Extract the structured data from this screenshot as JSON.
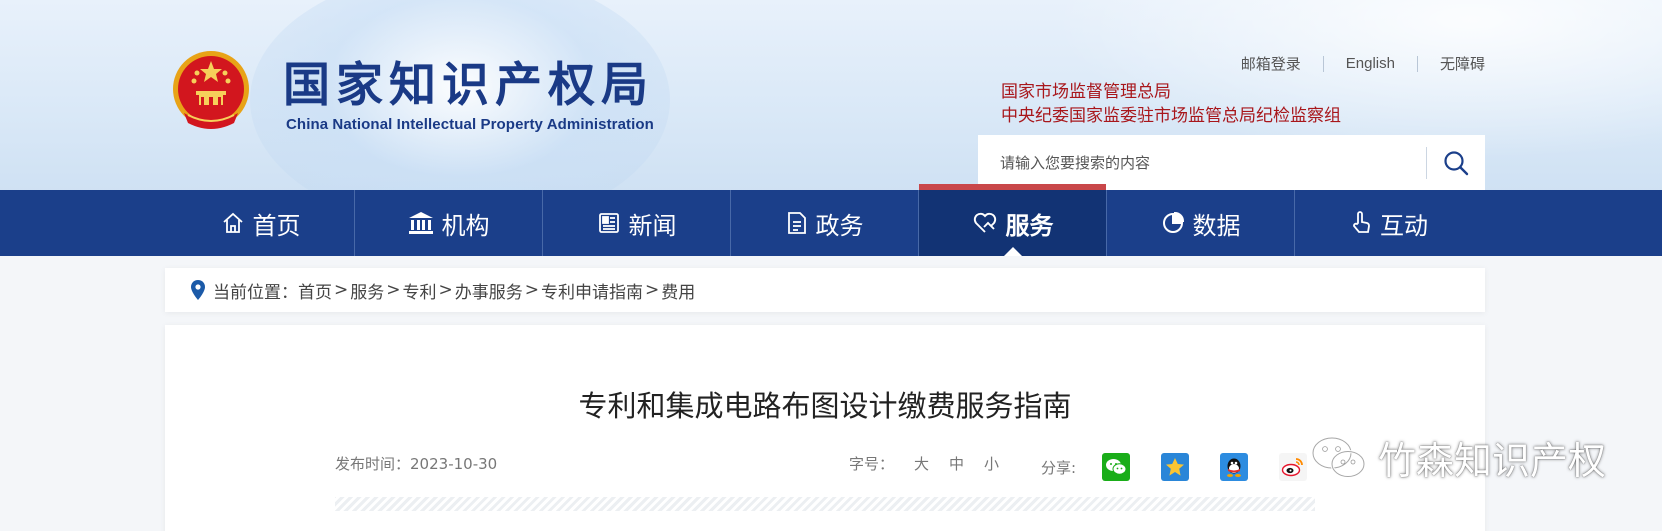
{
  "header": {
    "logo_cn": "国家知识产权局",
    "logo_en": "China National Intellectual Property Administration",
    "top_links": [
      "邮箱登录",
      "English",
      "无障碍"
    ],
    "orgs": [
      "国家市场监督管理总局",
      "中央纪委国家监委驻市场监管总局纪检监察组"
    ],
    "search_placeholder": "请输入您要搜索的内容"
  },
  "nav": {
    "items": [
      {
        "label": "首页",
        "icon": "home-icon"
      },
      {
        "label": "机构",
        "icon": "building-icon"
      },
      {
        "label": "新闻",
        "icon": "news-icon"
      },
      {
        "label": "政务",
        "icon": "document-icon"
      },
      {
        "label": "服务",
        "icon": "heart-hand-icon",
        "active": true
      },
      {
        "label": "数据",
        "icon": "pie-chart-icon"
      },
      {
        "label": "互动",
        "icon": "hand-pointer-icon"
      }
    ],
    "active_color": "#c9474a",
    "bar_color": "#1b3f8a"
  },
  "breadcrumb": {
    "prefix": "当前位置：",
    "items": [
      "首页",
      "服务",
      "专利",
      "办事服务",
      "专利申请指南",
      "费用"
    ],
    "separator": ">"
  },
  "article": {
    "title": "专利和集成电路布图设计缴费服务指南",
    "date_label": "发布时间：",
    "date": "2023-10-30",
    "fontsize_label": "字号：",
    "fontsize_options": [
      "大",
      "中",
      "小"
    ],
    "share_label": "分享:",
    "share_icons": [
      "wechat-icon",
      "qzone-icon",
      "qq-icon",
      "weibo-icon"
    ]
  },
  "watermark": {
    "text": "竹森知识产权",
    "icon": "wechat-outline-icon"
  }
}
